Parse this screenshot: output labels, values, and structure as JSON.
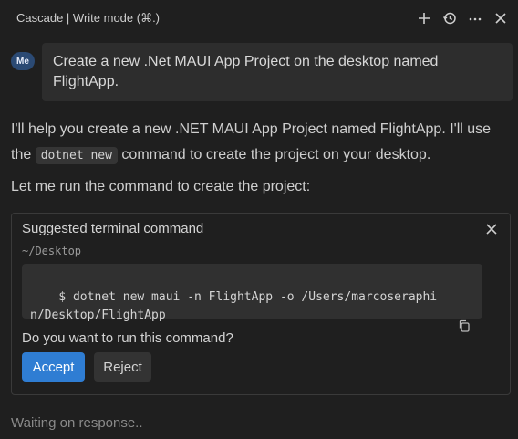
{
  "header": {
    "title": "Cascade | Write mode (⌘.)",
    "icons": [
      "plus-icon",
      "history-icon",
      "more-icon",
      "close-icon"
    ]
  },
  "user_message": {
    "avatar": "Me",
    "text": "Create a new .Net MAUI App Project on the desktop named FlightApp."
  },
  "assistant": {
    "p1_before": "I'll help you create a new .NET MAUI App Project named FlightApp. I'll use the ",
    "p1_code": "dotnet new",
    "p1_after": " command to create the project on your desktop.",
    "p2": "Let me run the command to create the project:"
  },
  "terminal_card": {
    "title": "Suggested terminal command",
    "path": "~/Desktop",
    "command": "$ dotnet new maui -n FlightApp -o /Users/marcoseraphin/Desktop/FlightApp",
    "question": "Do you want to run this command?",
    "accept_label": "Accept",
    "reject_label": "Reject"
  },
  "status": {
    "text": "Waiting on response.."
  },
  "colors": {
    "background": "#1f1f1f",
    "accent": "#2f7dd3",
    "bubble": "#2d2d2d"
  }
}
